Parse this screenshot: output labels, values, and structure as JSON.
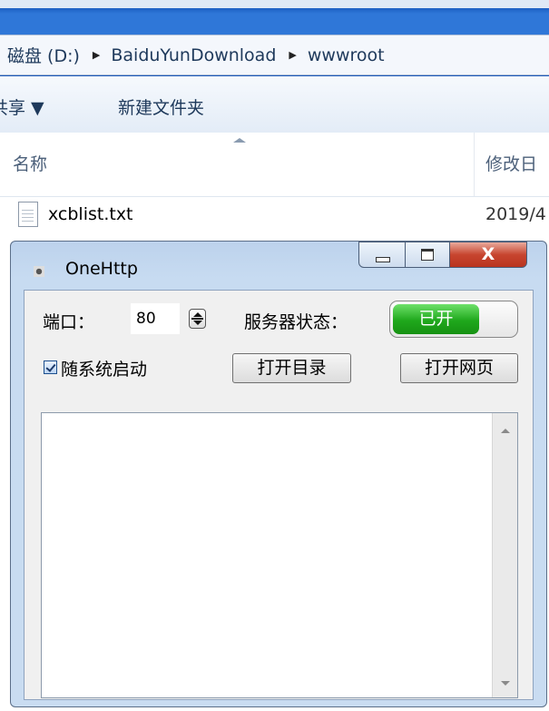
{
  "explorer": {
    "breadcrumbs": [
      "磁盘 (D:)",
      "BaiduYunDownload",
      "wwwroot"
    ],
    "toolbar": {
      "share_label": "共享 ▼",
      "new_folder_label": "新建文件夹"
    },
    "columns": {
      "name": "名称",
      "date": "修改日"
    },
    "files": [
      {
        "name": "xcblist.txt",
        "date": "2019/4"
      }
    ]
  },
  "app": {
    "title": "OneHttp",
    "port_label": "端口：",
    "port_value": "80",
    "server_status_label": "服务器状态：",
    "toggle_on_text": "已开",
    "server_on": true,
    "autostart_label": "随系统启动",
    "autostart_checked": true,
    "open_dir_button": "打开目录",
    "open_web_button": "打开网页",
    "close_glyph": "X",
    "log_text": ""
  },
  "colors": {
    "title_blue": "#2f77d8",
    "toggle_green": "#1fa81c",
    "close_red": "#c7452f"
  }
}
